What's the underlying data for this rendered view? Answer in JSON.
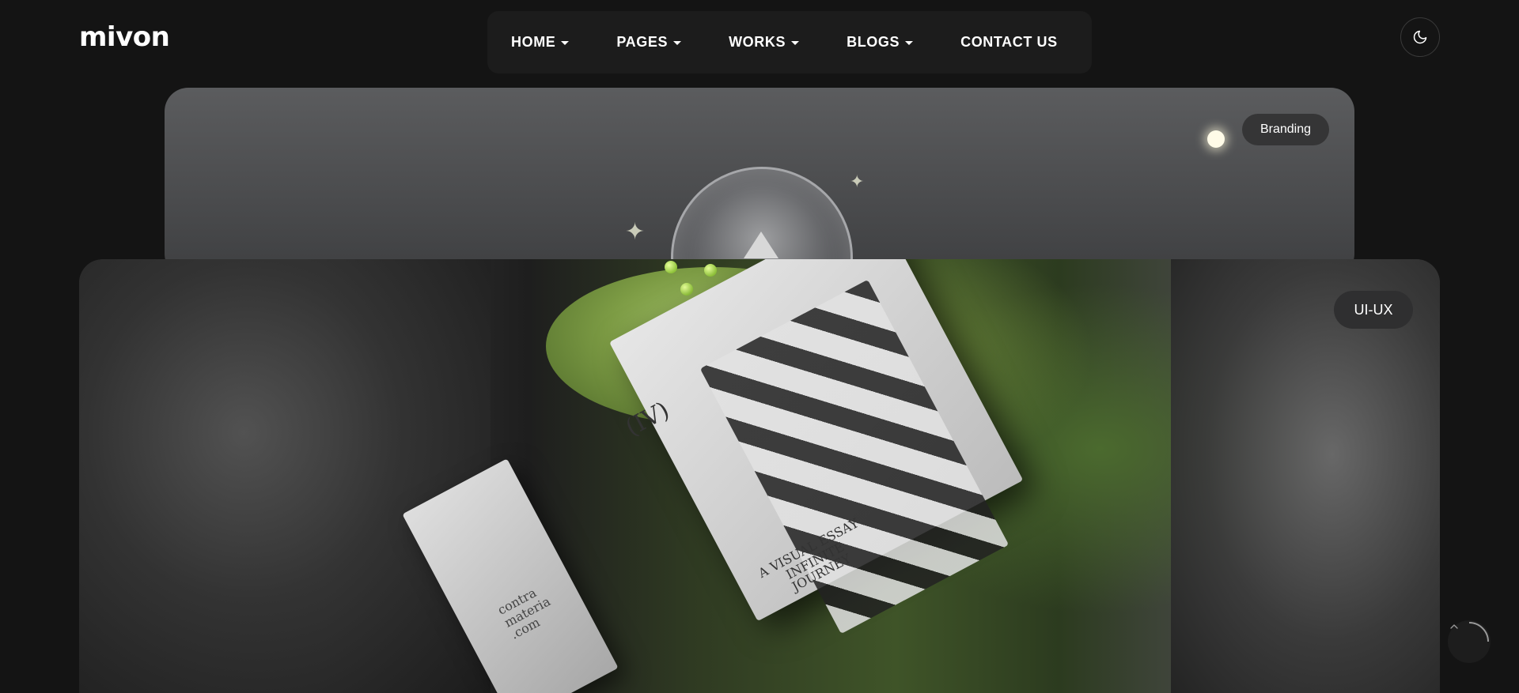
{
  "brand": {
    "logo_text": "mivon"
  },
  "nav": {
    "items": [
      {
        "label": "HOME",
        "has_dropdown": true
      },
      {
        "label": "PAGES",
        "has_dropdown": true
      },
      {
        "label": "WORKS",
        "has_dropdown": true
      },
      {
        "label": "BLOGS",
        "has_dropdown": true
      },
      {
        "label": "CONTACT US",
        "has_dropdown": false
      }
    ]
  },
  "header": {
    "theme_toggle_icon": "moon-icon"
  },
  "projects": [
    {
      "tag": "Branding"
    },
    {
      "tag": "UI-UX",
      "book_numeral": "(IV)",
      "book_title": "A VISUAL ESSAY\nINFINITE\nJOURNEY",
      "slip_text": "contra\nmateria\n.com"
    }
  ],
  "scroll_top": {
    "icon": "chevron-up-icon"
  },
  "colors": {
    "background": "#141414",
    "nav_bg": "#1c1c1c",
    "accent_green": "#8fc23a"
  }
}
